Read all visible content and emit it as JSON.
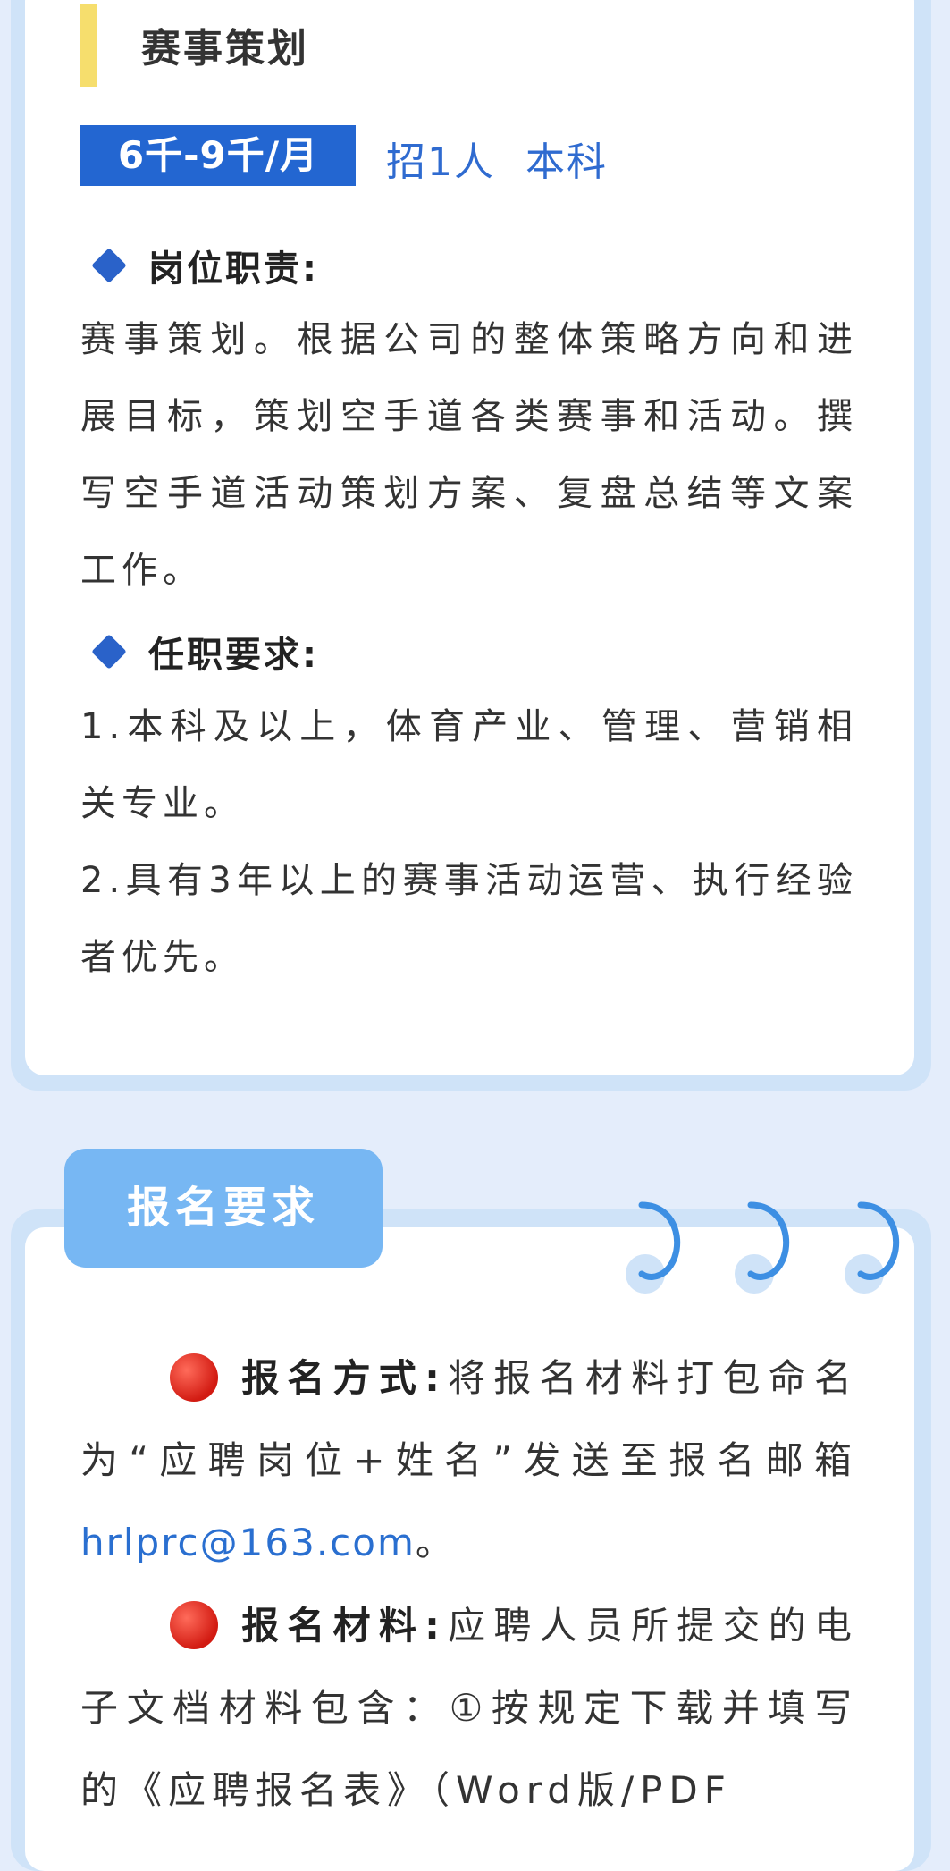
{
  "job": {
    "title": "赛事策划",
    "salary": "6千-9千/月",
    "headcount": "招1人",
    "education": "本科"
  },
  "duties": {
    "heading": "岗位职责:",
    "text": "赛事策划。根据公司的整体策略方向和进展目标，策划空手道各类赛事和活动。撰写空手道活动策划方案、复盘总结等文案工作。"
  },
  "requirements": {
    "heading": "任职要求:",
    "item1": "1.本科及以上，体育产业、管理、营销相关专业。",
    "item2": "2.具有3年以上的赛事活动运营、执行经验者优先。"
  },
  "apply": {
    "tab_label": "报名要求",
    "method_label": "报名方式:",
    "method_text": "将报名材料打包命名为“应聘岗位+姓名”发送至报名邮箱",
    "email": "hrlprc@163.com",
    "method_end": "。",
    "materials_label": "报名材料:",
    "materials_text": "应聘人员所提交的电子文档材料包含：①按规定下载并填写的《应聘报名表》（Word版/PDF"
  },
  "colors": {
    "accent_blue": "#2366d1",
    "tab_blue": "#77b7f3",
    "title_bar_yellow": "#f6de6d",
    "page_bg": "#e4edfb",
    "card_border": "#cfe3f8"
  }
}
